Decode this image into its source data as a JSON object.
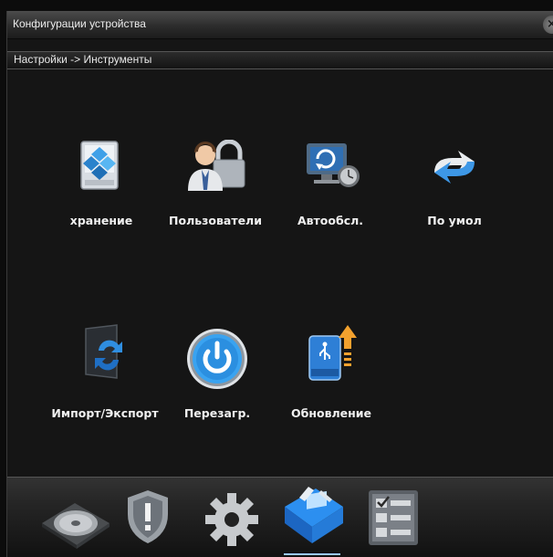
{
  "window": {
    "title": "Конфигурации устройства"
  },
  "breadcrumb": {
    "text": "Настройки -> Инструменты"
  },
  "tools": [
    {
      "label": "хранение",
      "icon": "storage-icon"
    },
    {
      "label": "Пользователи",
      "icon": "users-lock-icon"
    },
    {
      "label": "Автообсл.",
      "icon": "auto-maintenance-icon"
    },
    {
      "label": "По умол",
      "icon": "default-reset-icon"
    },
    {
      "label": "Импорт/Экспорт",
      "icon": "import-export-icon"
    },
    {
      "label": "Перезагр.",
      "icon": "power-restart-icon"
    },
    {
      "label": "Обновление",
      "icon": "usb-upgrade-icon"
    }
  ],
  "dock": [
    {
      "icon": "disk-icon"
    },
    {
      "icon": "alarm-shield-icon"
    },
    {
      "icon": "gear-icon"
    },
    {
      "icon": "tools-monitor-icon",
      "active": true
    },
    {
      "icon": "checklist-icon"
    }
  ]
}
